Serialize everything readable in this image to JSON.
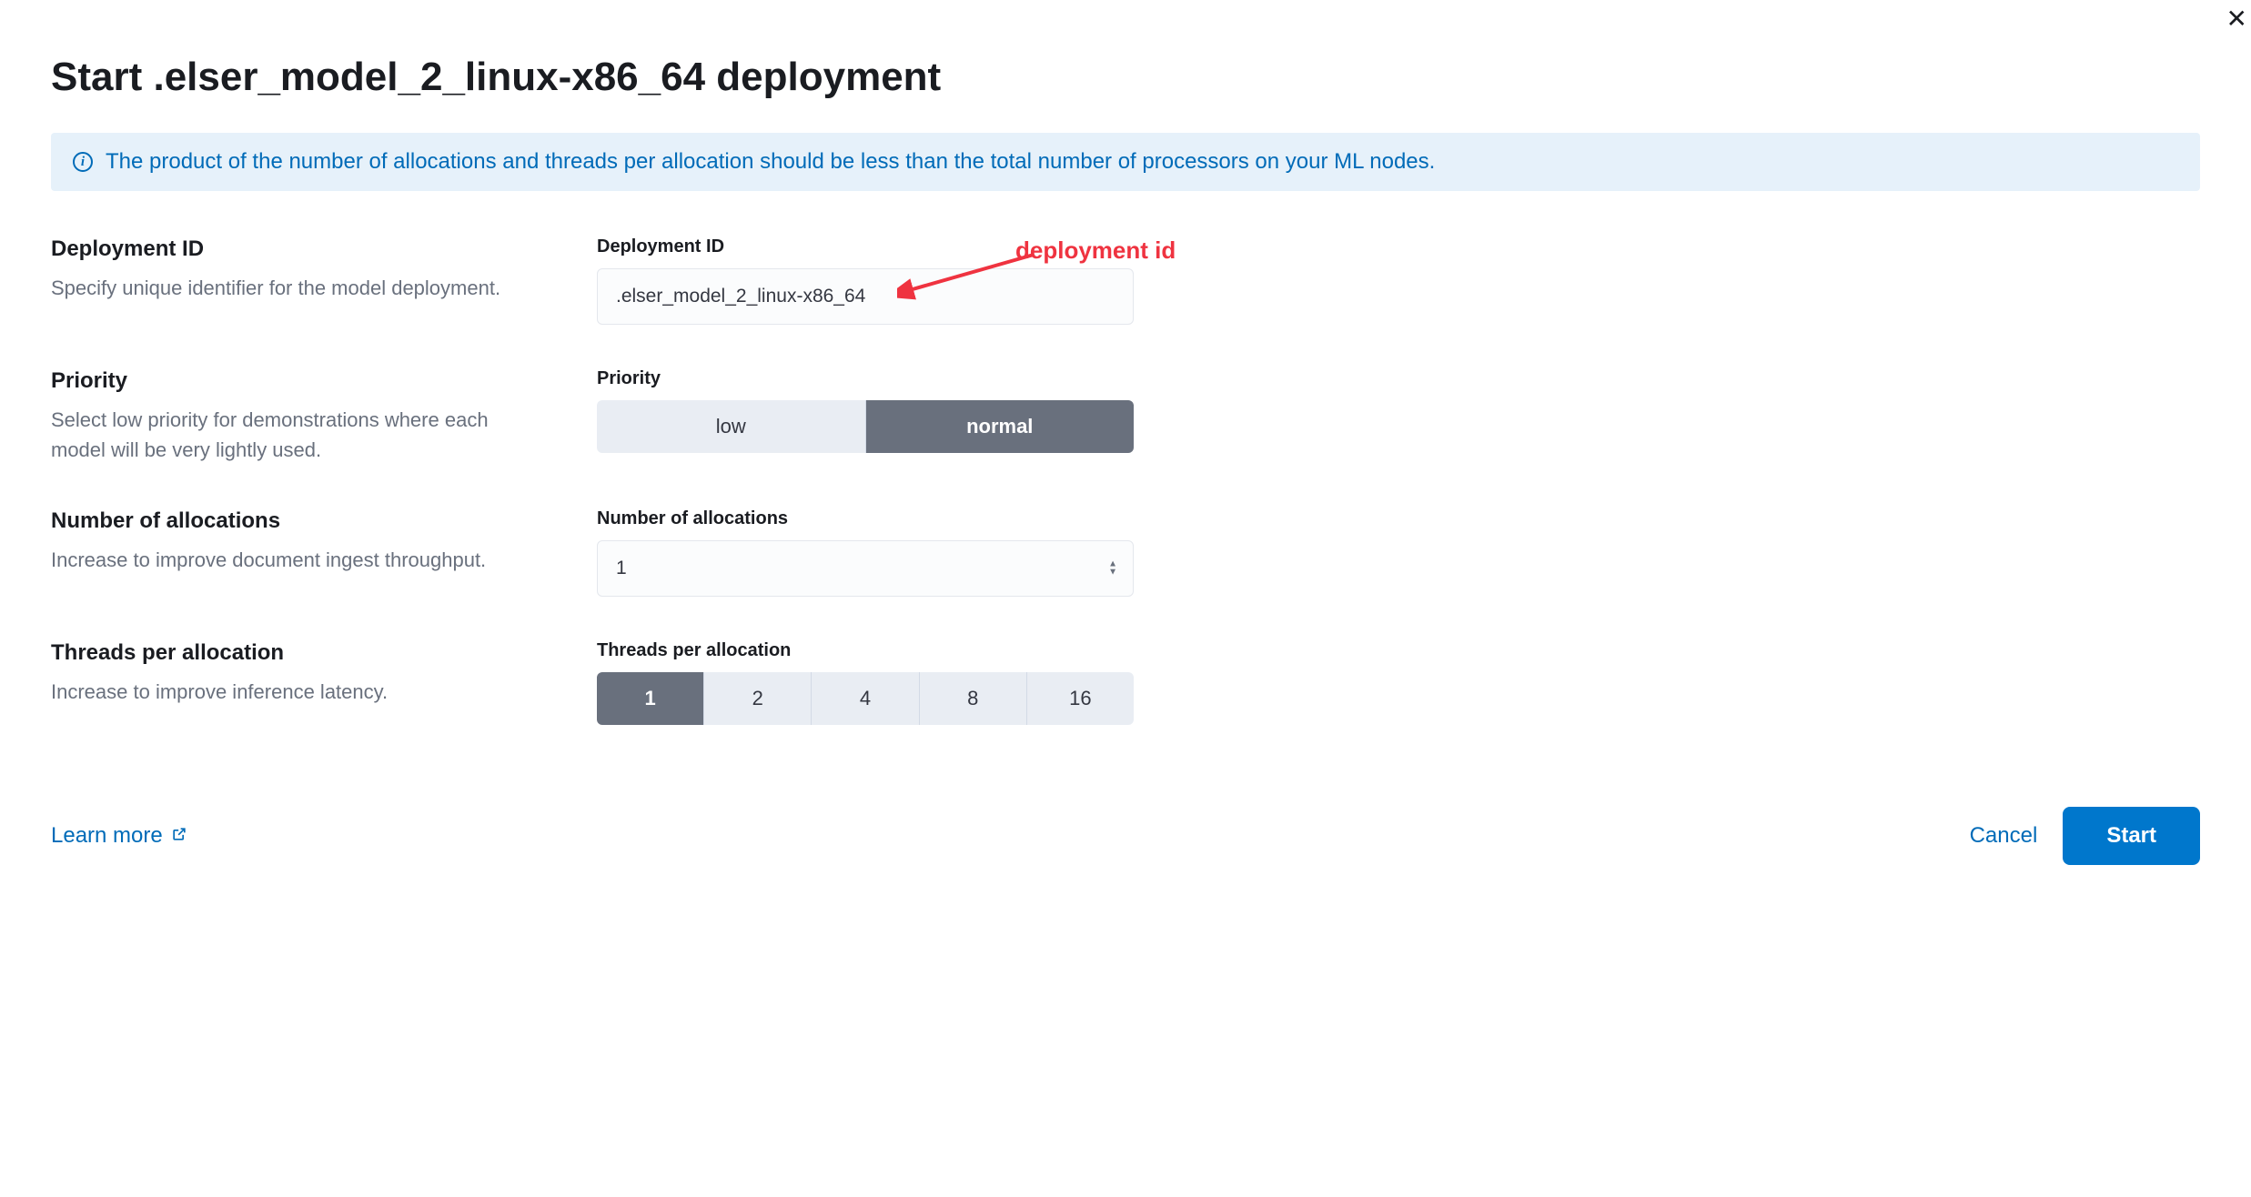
{
  "title": "Start .elser_model_2_linux-x86_64 deployment",
  "callout": {
    "text": "The product of the number of allocations and threads per allocation should be less than the total number of processors on your ML nodes."
  },
  "deployment_id": {
    "left_title": "Deployment ID",
    "left_desc": "Specify unique identifier for the model deployment.",
    "field_label": "Deployment ID",
    "value": ".elser_model_2_linux-x86_64"
  },
  "priority": {
    "left_title": "Priority",
    "left_desc": "Select low priority for demonstrations where each model will be very lightly used.",
    "field_label": "Priority",
    "low_label": "low",
    "normal_label": "normal",
    "selected": "normal"
  },
  "allocations": {
    "left_title": "Number of allocations",
    "left_desc": "Increase to improve document ingest throughput.",
    "field_label": "Number of allocations",
    "value": "1"
  },
  "threads": {
    "left_title": "Threads per allocation",
    "left_desc": "Increase to improve inference latency.",
    "field_label": "Threads per allocation",
    "options": [
      "1",
      "2",
      "4",
      "8",
      "16"
    ],
    "selected": "1"
  },
  "footer": {
    "learn": "Learn more",
    "cancel": "Cancel",
    "start": "Start"
  },
  "annotation": {
    "label": "deployment id"
  }
}
